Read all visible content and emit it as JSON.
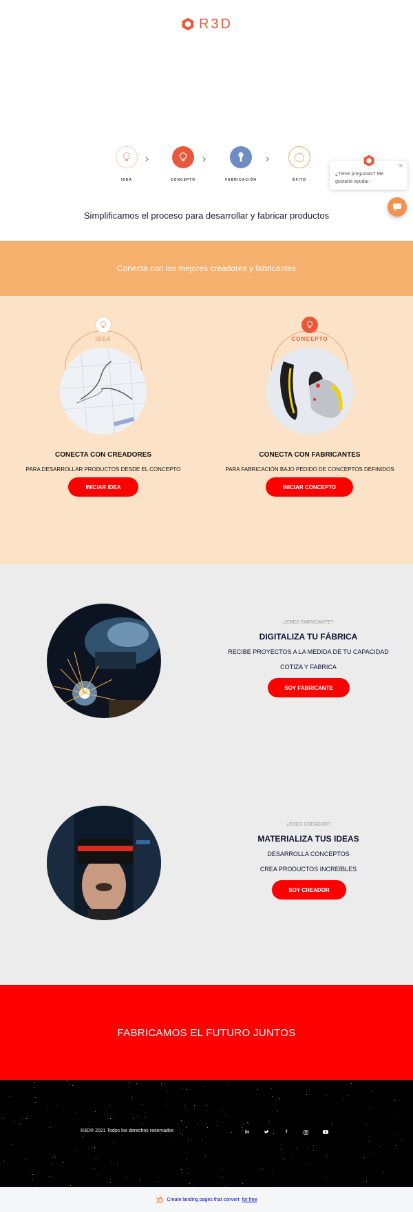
{
  "header": {
    "logo_text": "R3D",
    "steps": [
      {
        "label": "IDEA",
        "icon": "lightbulb-outline-icon",
        "color": "#f3c9bd"
      },
      {
        "label": "CONCEPTO",
        "icon": "lightbulb-filled-icon",
        "color": "#e9583a"
      },
      {
        "label": "FABRICACIÓN",
        "icon": "wrench-icon",
        "color": "#6d8dc4"
      },
      {
        "label": "ÉXITO",
        "icon": "cube-icon",
        "color": "#d9b36b"
      }
    ],
    "tagline": "Simplificamos el proceso para desarrollar y fabricar productos"
  },
  "chat": {
    "message": "¿Tiene preguntas? Me gustaría ayudar."
  },
  "band": {
    "title": "Conecta con los mejores creadores y fabricantes"
  },
  "cards": [
    {
      "badge": "IDEA",
      "heading": "CONECTA CON CREADORES",
      "text": "PARA DESARROLLAR PRODUCTOS DESDE EL CONCEPTO",
      "button": "INICIAR IDEA"
    },
    {
      "badge": "CONCEPTO",
      "heading": "CONECTA CON FABRICANTES",
      "text": "PARA FABRICACIÓN BAJO PEDIDO DE CONCEPTOS DEFINIDOS",
      "button": "INICIAR CONCEPTO"
    }
  ],
  "manufacturer": {
    "eyebrow": "¿ERES FABRICANTE?",
    "title": "DIGITALIZA TU FÁBRICA",
    "line1": "RECIBE PROYECTOS A LA MEDIDA DE TU CAPACIDAD",
    "line2": "COTIZA Y FABRICA",
    "button": "SOY FABRICANTE"
  },
  "creator": {
    "eyebrow": "¿ERES CREADOR?",
    "title": "MATERIALIZA TUS IDEAS",
    "line1": "DESARROLLA CONCEPTOS",
    "line2": "CREA PRODUCTOS INCREÍBLES",
    "button": "SOY CREADOR"
  },
  "cta": {
    "title": "FABRICAMOS EL FUTURO JUNTOS"
  },
  "footer": {
    "copyright": "R3D® 2021 Todos los derechos reservados",
    "social": [
      {
        "icon": "linkedin-icon",
        "glyph": "in"
      },
      {
        "icon": "twitter-icon",
        "glyph": "🐦"
      },
      {
        "icon": "facebook-icon",
        "glyph": "f"
      },
      {
        "icon": "instagram-icon",
        "glyph": "◎"
      },
      {
        "icon": "youtube-icon",
        "glyph": "▶"
      }
    ]
  },
  "bottom_bar": {
    "lead": "Create landing pages that convert",
    "link": "for free"
  },
  "colors": {
    "accent_red": "#ff0000",
    "brand_orange": "#e9583a",
    "band_orange": "#f5b06d",
    "peach": "#fce3c7",
    "grey": "#ececec"
  }
}
